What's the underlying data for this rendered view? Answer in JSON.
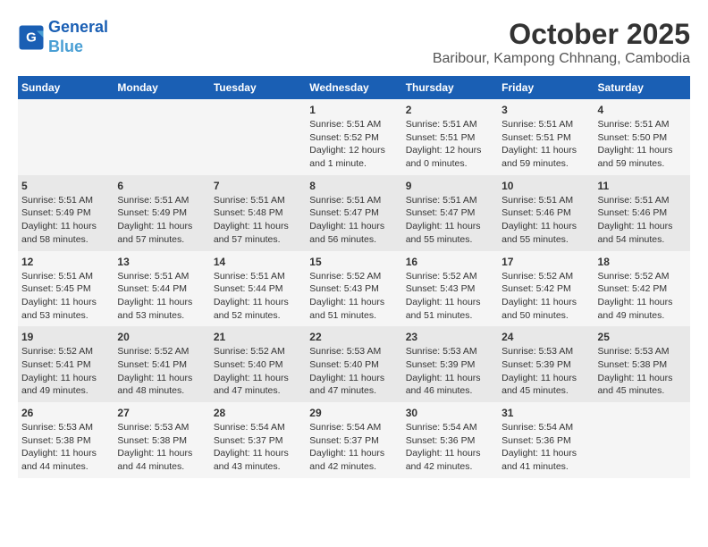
{
  "header": {
    "logo_line1": "General",
    "logo_line2": "Blue",
    "month_title": "October 2025",
    "location": "Baribour, Kampong Chhnang, Cambodia"
  },
  "weekdays": [
    "Sunday",
    "Monday",
    "Tuesday",
    "Wednesday",
    "Thursday",
    "Friday",
    "Saturday"
  ],
  "weeks": [
    [
      {
        "day": "",
        "info": ""
      },
      {
        "day": "",
        "info": ""
      },
      {
        "day": "",
        "info": ""
      },
      {
        "day": "1",
        "info": "Sunrise: 5:51 AM\nSunset: 5:52 PM\nDaylight: 12 hours\nand 1 minute."
      },
      {
        "day": "2",
        "info": "Sunrise: 5:51 AM\nSunset: 5:51 PM\nDaylight: 12 hours\nand 0 minutes."
      },
      {
        "day": "3",
        "info": "Sunrise: 5:51 AM\nSunset: 5:51 PM\nDaylight: 11 hours\nand 59 minutes."
      },
      {
        "day": "4",
        "info": "Sunrise: 5:51 AM\nSunset: 5:50 PM\nDaylight: 11 hours\nand 59 minutes."
      }
    ],
    [
      {
        "day": "5",
        "info": "Sunrise: 5:51 AM\nSunset: 5:49 PM\nDaylight: 11 hours\nand 58 minutes."
      },
      {
        "day": "6",
        "info": "Sunrise: 5:51 AM\nSunset: 5:49 PM\nDaylight: 11 hours\nand 57 minutes."
      },
      {
        "day": "7",
        "info": "Sunrise: 5:51 AM\nSunset: 5:48 PM\nDaylight: 11 hours\nand 57 minutes."
      },
      {
        "day": "8",
        "info": "Sunrise: 5:51 AM\nSunset: 5:47 PM\nDaylight: 11 hours\nand 56 minutes."
      },
      {
        "day": "9",
        "info": "Sunrise: 5:51 AM\nSunset: 5:47 PM\nDaylight: 11 hours\nand 55 minutes."
      },
      {
        "day": "10",
        "info": "Sunrise: 5:51 AM\nSunset: 5:46 PM\nDaylight: 11 hours\nand 55 minutes."
      },
      {
        "day": "11",
        "info": "Sunrise: 5:51 AM\nSunset: 5:46 PM\nDaylight: 11 hours\nand 54 minutes."
      }
    ],
    [
      {
        "day": "12",
        "info": "Sunrise: 5:51 AM\nSunset: 5:45 PM\nDaylight: 11 hours\nand 53 minutes."
      },
      {
        "day": "13",
        "info": "Sunrise: 5:51 AM\nSunset: 5:44 PM\nDaylight: 11 hours\nand 53 minutes."
      },
      {
        "day": "14",
        "info": "Sunrise: 5:51 AM\nSunset: 5:44 PM\nDaylight: 11 hours\nand 52 minutes."
      },
      {
        "day": "15",
        "info": "Sunrise: 5:52 AM\nSunset: 5:43 PM\nDaylight: 11 hours\nand 51 minutes."
      },
      {
        "day": "16",
        "info": "Sunrise: 5:52 AM\nSunset: 5:43 PM\nDaylight: 11 hours\nand 51 minutes."
      },
      {
        "day": "17",
        "info": "Sunrise: 5:52 AM\nSunset: 5:42 PM\nDaylight: 11 hours\nand 50 minutes."
      },
      {
        "day": "18",
        "info": "Sunrise: 5:52 AM\nSunset: 5:42 PM\nDaylight: 11 hours\nand 49 minutes."
      }
    ],
    [
      {
        "day": "19",
        "info": "Sunrise: 5:52 AM\nSunset: 5:41 PM\nDaylight: 11 hours\nand 49 minutes."
      },
      {
        "day": "20",
        "info": "Sunrise: 5:52 AM\nSunset: 5:41 PM\nDaylight: 11 hours\nand 48 minutes."
      },
      {
        "day": "21",
        "info": "Sunrise: 5:52 AM\nSunset: 5:40 PM\nDaylight: 11 hours\nand 47 minutes."
      },
      {
        "day": "22",
        "info": "Sunrise: 5:53 AM\nSunset: 5:40 PM\nDaylight: 11 hours\nand 47 minutes."
      },
      {
        "day": "23",
        "info": "Sunrise: 5:53 AM\nSunset: 5:39 PM\nDaylight: 11 hours\nand 46 minutes."
      },
      {
        "day": "24",
        "info": "Sunrise: 5:53 AM\nSunset: 5:39 PM\nDaylight: 11 hours\nand 45 minutes."
      },
      {
        "day": "25",
        "info": "Sunrise: 5:53 AM\nSunset: 5:38 PM\nDaylight: 11 hours\nand 45 minutes."
      }
    ],
    [
      {
        "day": "26",
        "info": "Sunrise: 5:53 AM\nSunset: 5:38 PM\nDaylight: 11 hours\nand 44 minutes."
      },
      {
        "day": "27",
        "info": "Sunrise: 5:53 AM\nSunset: 5:38 PM\nDaylight: 11 hours\nand 44 minutes."
      },
      {
        "day": "28",
        "info": "Sunrise: 5:54 AM\nSunset: 5:37 PM\nDaylight: 11 hours\nand 43 minutes."
      },
      {
        "day": "29",
        "info": "Sunrise: 5:54 AM\nSunset: 5:37 PM\nDaylight: 11 hours\nand 42 minutes."
      },
      {
        "day": "30",
        "info": "Sunrise: 5:54 AM\nSunset: 5:36 PM\nDaylight: 11 hours\nand 42 minutes."
      },
      {
        "day": "31",
        "info": "Sunrise: 5:54 AM\nSunset: 5:36 PM\nDaylight: 11 hours\nand 41 minutes."
      },
      {
        "day": "",
        "info": ""
      }
    ]
  ]
}
